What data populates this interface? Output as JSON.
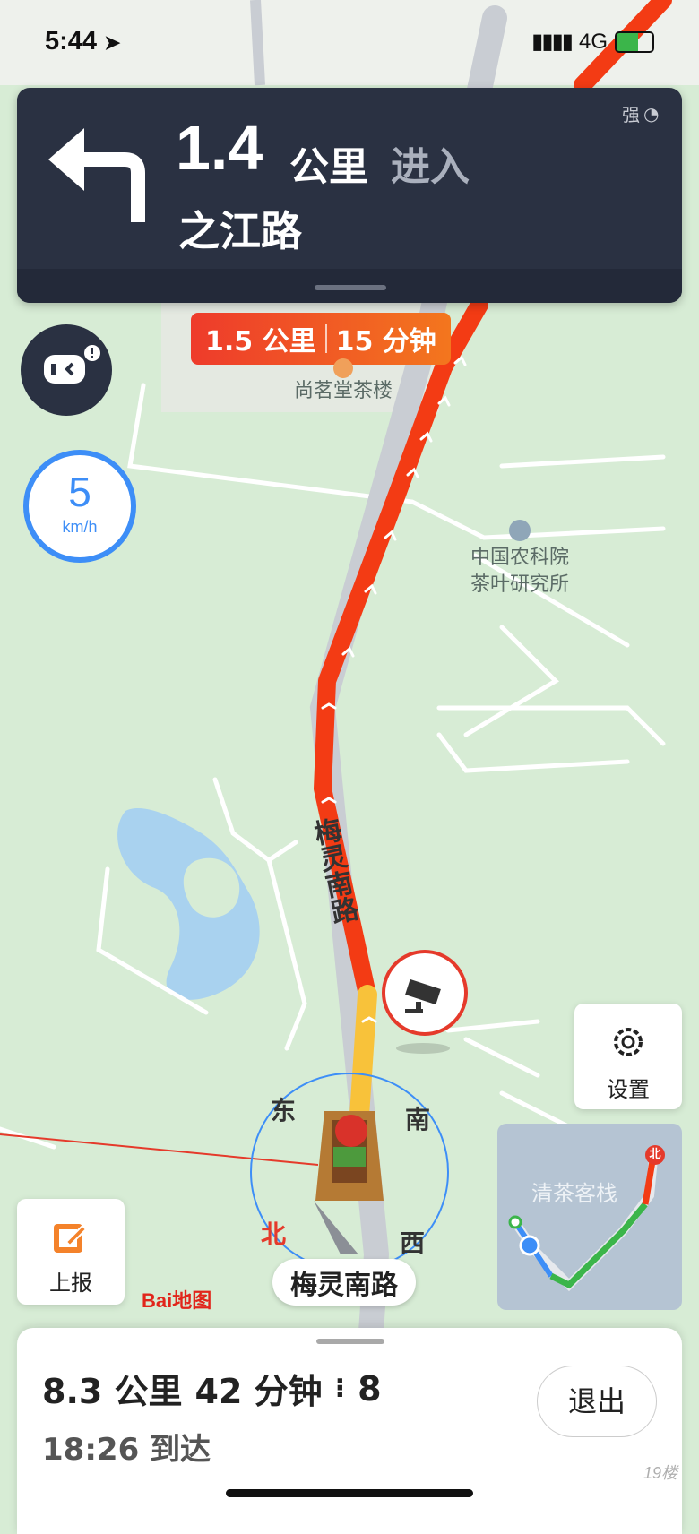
{
  "status_bar": {
    "time": "5:44",
    "network": "4G",
    "location_icon": "location-arrow-icon",
    "signal_icon": "cellular-signal-icon",
    "battery_icon": "battery-charging-icon"
  },
  "navigation": {
    "turn_icon": "turn-left-arrow-icon",
    "distance_value": "1.4",
    "distance_unit": "公里",
    "action": "进入",
    "road_name": "之江路",
    "signal_label": "强",
    "signal_icon": "gps-signal-icon"
  },
  "route_eta_bubble": {
    "distance": "1.5 公里",
    "time": "15 分钟"
  },
  "speed": {
    "value": "5",
    "unit": "km/h"
  },
  "map": {
    "poi_labels": [
      "尚茗堂茶楼",
      "中国农科院",
      "茶叶研究所",
      "清茶客栈"
    ],
    "road_label": "梅灵南路",
    "compass": {
      "east": "东",
      "south": "南",
      "north": "北",
      "west": "西"
    },
    "minimap_north": "北",
    "current_road": "梅灵南路",
    "brand": "Bai地图",
    "colors": {
      "map_bg": "#d7ecd5",
      "route_red": "#f33b14",
      "route_yellow": "#f8c23a",
      "route_green": "#3bb54a",
      "water": "#a9d2ef"
    }
  },
  "buttons": {
    "settings": "设置",
    "report": "上报",
    "exit": "退出"
  },
  "bottom_panel": {
    "summary_distance": "8.3 公里",
    "summary_time": "42 分钟",
    "traffic_lights": "8",
    "arrival": "18:26 到达"
  },
  "watermark": "19楼"
}
